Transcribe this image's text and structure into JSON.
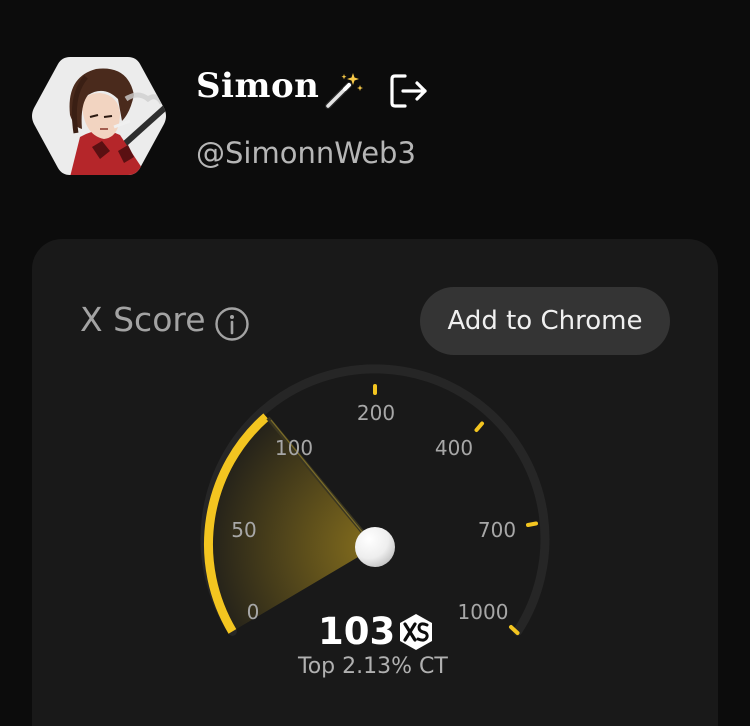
{
  "profile": {
    "name": "Simon",
    "handle": "@SimonnWeb3"
  },
  "score_card": {
    "label": "X Score",
    "add_button_label": "Add to Chrome",
    "score": "103",
    "rank": "Top 2.13% CT"
  },
  "gauge": {
    "tick_labels": [
      "0",
      "50",
      "100",
      "200",
      "400",
      "700",
      "1000"
    ],
    "needle_value": 103
  },
  "icons": {
    "wand": "magic-wand-icon",
    "logout": "logout-icon",
    "info": "info-icon",
    "brand": "xs-logo-icon"
  },
  "colors": {
    "accent": "#f3c520",
    "card_bg": "#191919",
    "page_bg": "#0c0c0c",
    "button_bg": "#343434"
  }
}
